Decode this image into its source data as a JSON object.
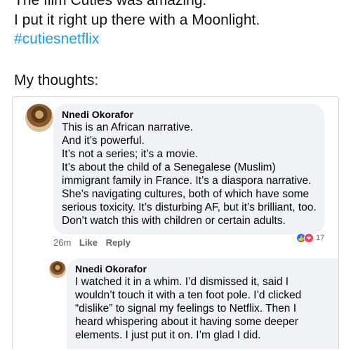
{
  "tweet": {
    "lines": [
      "The film Cuties was amazing.",
      "I put it right up there with a Moonlight."
    ],
    "hashtag": "#cutiesnetflix",
    "thoughts_label": "My thoughts:"
  },
  "comment": {
    "author": "Nnedi Okorafor",
    "lines": [
      "This is an African narrative.",
      "And it’s powerful.",
      "It’s not a series; it’s a movie.",
      "It’s about the child of a Senegalese (Muslim)",
      "immigrant family in France. It’s a diaspora narrative.",
      "She’s navigating cultures, both of which have some",
      "serious toxicity. It’s disturbing AF, but it’s brilliant, too.",
      "Don’t watch this with children or certain adults."
    ],
    "time": "26m",
    "like_label": "Like",
    "reply_label": "Reply",
    "reaction_count": "17",
    "reaction_icons": [
      "like-icon",
      "love-icon"
    ]
  },
  "reply": {
    "author": "Nnedi Okorafor",
    "lines": [
      "I watched it in a whim. I’d dismissed it, said I",
      "wouldn’t touch it with a ten foot pole. I’d clicked",
      "“dislike” to signal my feelings to Netflix. Then I",
      "heard whispering about it having some deeper",
      "elements. I just put it on. I’m glad I did."
    ]
  },
  "colors": {
    "hashtag": "#1d9bf0",
    "bubble": "#f0f2f5",
    "like": "#1877f2",
    "love": "#f33e58"
  }
}
